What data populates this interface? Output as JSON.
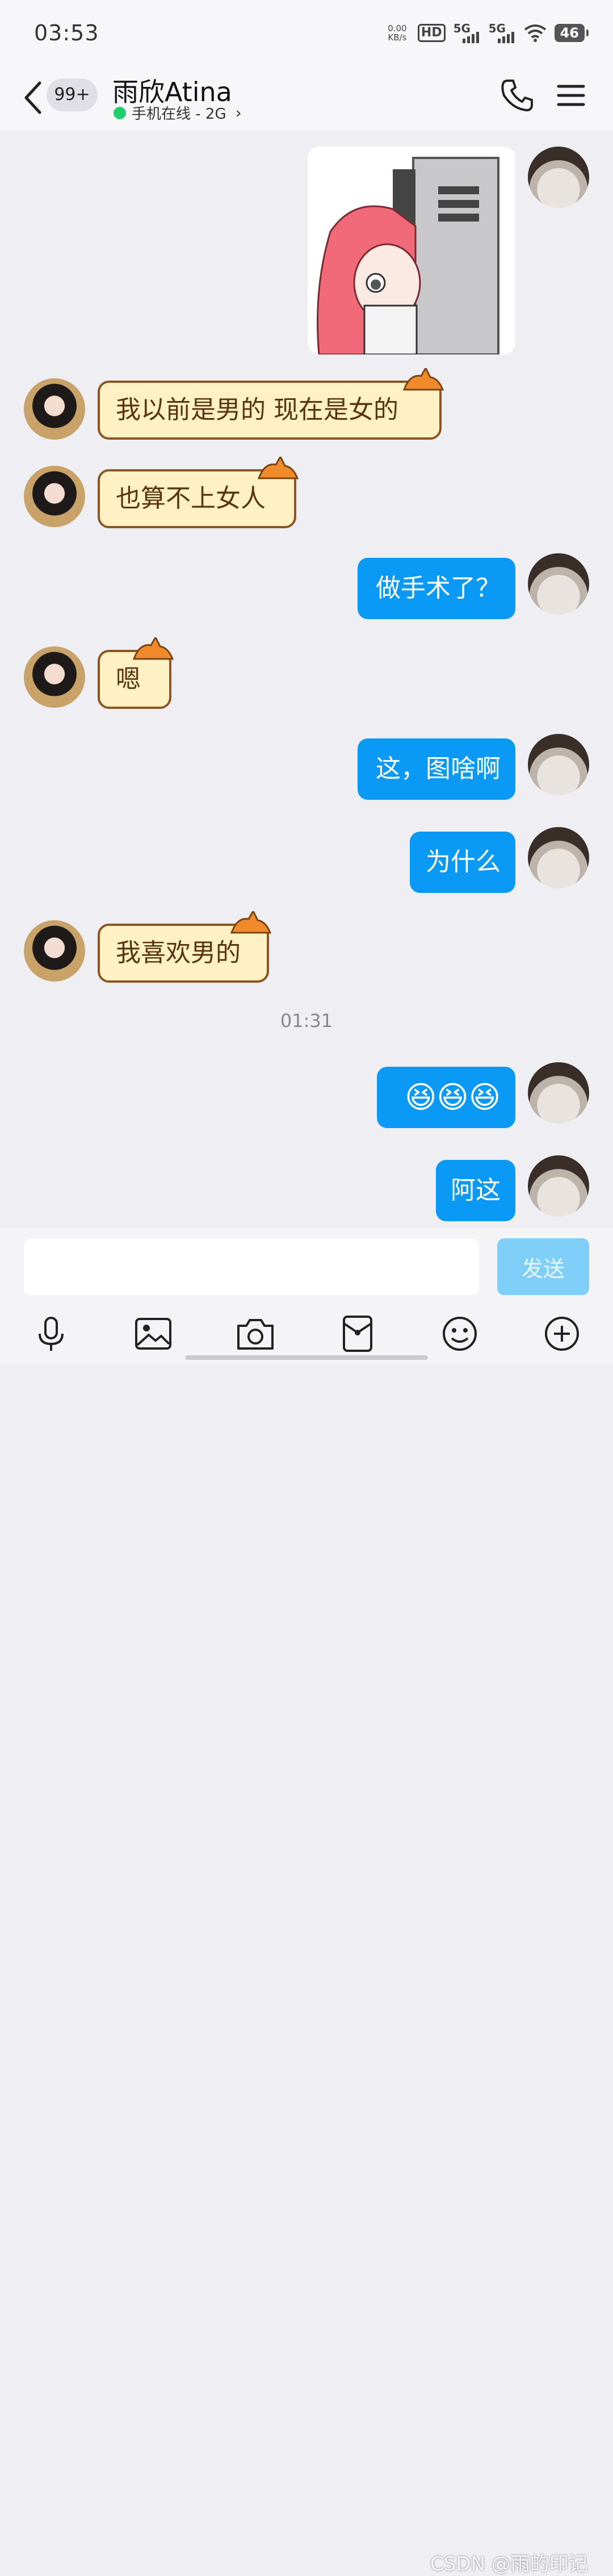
{
  "status_bar": {
    "time": "03:53",
    "net_speed_value": "0.00",
    "net_speed_unit": "KB/s",
    "hd_label": "HD",
    "sim1_label": "5G",
    "sim2_label": "5G",
    "battery": "46"
  },
  "header": {
    "unread_count": "99+",
    "contact_name": "雨欣Atina",
    "online_status": "手机在线 - 2G"
  },
  "messages": [
    {
      "from": "self",
      "type": "sticker"
    },
    {
      "from": "other",
      "text": "我以前是男的  现在是女的"
    },
    {
      "from": "other",
      "text": "也算不上女人"
    },
    {
      "from": "self",
      "text": "做手术了？"
    },
    {
      "from": "other",
      "text": "嗯"
    },
    {
      "from": "self",
      "text": "这，图啥啊"
    },
    {
      "from": "self",
      "text": "为什么"
    },
    {
      "from": "other",
      "text": "我喜欢男的"
    },
    {
      "from": "self",
      "text": "😆😆😆"
    },
    {
      "from": "self",
      "text": "阿这"
    }
  ],
  "timestamp": "01:31",
  "input": {
    "placeholder": "",
    "send_label": "发送"
  },
  "toolbar": [
    "mic-icon",
    "image-icon",
    "camera-icon",
    "red-packet-icon",
    "emoji-icon",
    "add-icon"
  ],
  "watermark": "CSDN @雨的印记",
  "colors": {
    "self_bubble": "#0a99f5",
    "other_bubble": "#fff1c4",
    "send_button": "#7fcff8",
    "online_dot": "#1fcf6e"
  }
}
